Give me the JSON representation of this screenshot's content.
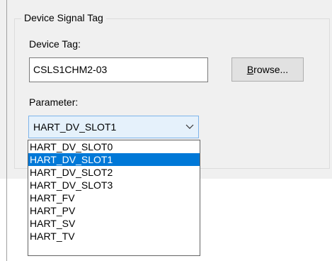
{
  "group": {
    "title": "Device Signal Tag"
  },
  "device_tag": {
    "label": "Device Tag:",
    "value": "CSLS1CHM2-03",
    "browse_label": "Browse..."
  },
  "parameter": {
    "label": "Parameter:",
    "selected": "HART_DV_SLOT1",
    "selected_index": 1,
    "options": [
      "HART_DV_SLOT0",
      "HART_DV_SLOT1",
      "HART_DV_SLOT2",
      "HART_DV_SLOT3",
      "HART_FV",
      "HART_PV",
      "HART_SV",
      "HART_TV"
    ]
  },
  "colors": {
    "dialog_bg": "#f0f0f0",
    "selection": "#0078d7",
    "combo_bg": "#e5f1fb",
    "combo_border": "#7eb4ea"
  }
}
